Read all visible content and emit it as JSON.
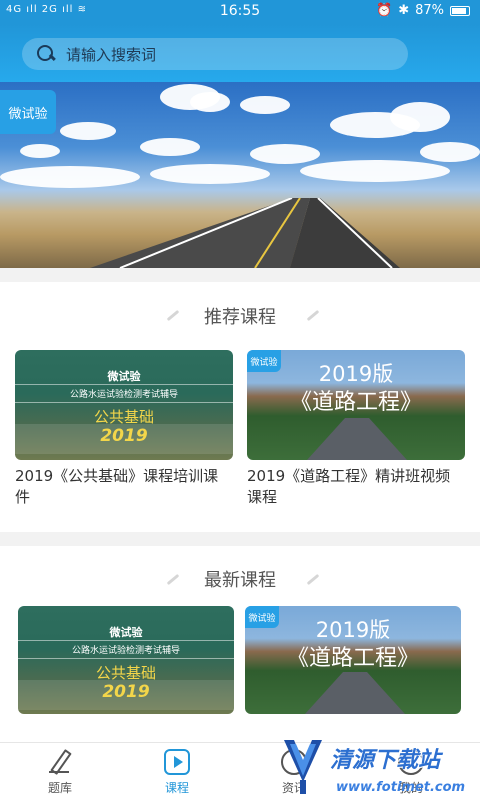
{
  "status_bar": {
    "left": "4G ıll 2G ıll ≋",
    "time": "16:55",
    "battery_text": "87%",
    "icons": [
      "alarm-icon",
      "bluetooth-icon",
      "battery-icon"
    ]
  },
  "search": {
    "placeholder": "请输入搜索词",
    "icon": "search-icon"
  },
  "banner": {
    "badge": "微试验"
  },
  "recommended": {
    "title": "推荐课程",
    "items": [
      {
        "thumb": {
          "brand": "微试验",
          "subtitle": "公路水运试验检测考试辅导",
          "topic": "公共基础",
          "year": "2019"
        },
        "title": "2019《公共基础》课程培训课件"
      },
      {
        "thumb": {
          "badge": "微试验",
          "year": "2019版",
          "name": "《道路工程》"
        },
        "title": "2019《道路工程》精讲班视频课程"
      }
    ]
  },
  "latest": {
    "title": "最新课程",
    "items": [
      {
        "thumb": {
          "brand": "微试验",
          "subtitle": "公路水运试验检测考试辅导",
          "topic": "公共基础",
          "year": "2019"
        }
      },
      {
        "thumb": {
          "badge": "微试验",
          "year": "2019版",
          "name": "《道路工程》"
        }
      }
    ]
  },
  "tabbar": {
    "items": [
      {
        "label": "题库",
        "icon": "pencil-icon"
      },
      {
        "label": "课程",
        "icon": "play-icon",
        "active": true
      },
      {
        "label": "资讯",
        "icon": "news-icon"
      },
      {
        "label": "我的",
        "icon": "user-icon"
      }
    ]
  },
  "watermark": {
    "text": "清源下载站",
    "url": "www.fotimet.com"
  },
  "colors": {
    "primary": "#2196d8",
    "badge": "#28a0e5",
    "accent_yellow": "#f3d64a"
  }
}
